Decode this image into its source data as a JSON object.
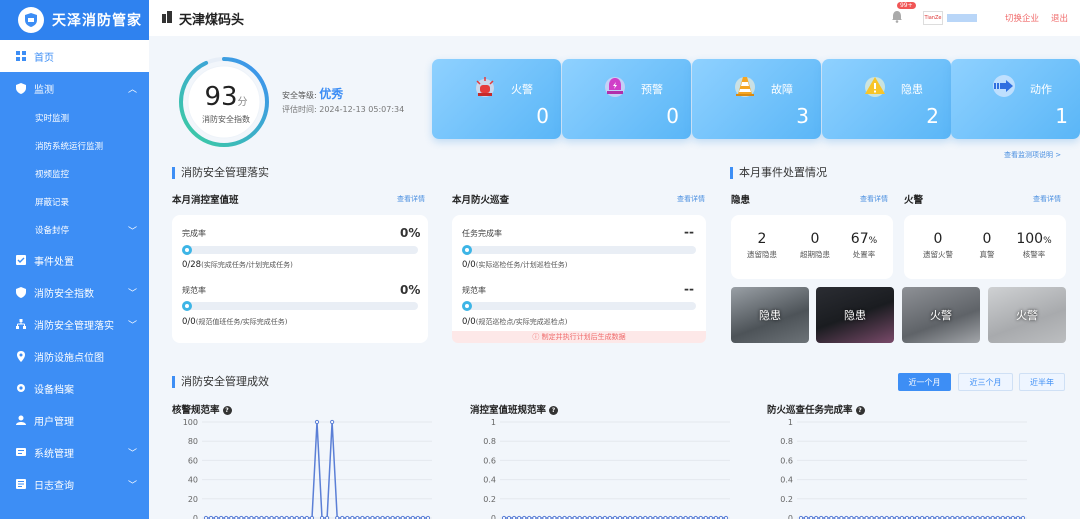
{
  "brand": {
    "title": "天泽消防管家"
  },
  "sidebar": {
    "items": [
      {
        "label": "首页",
        "active": true,
        "icon": "grid-icon"
      },
      {
        "label": "监测",
        "icon": "shield-icon",
        "expanded": true,
        "children": [
          {
            "label": "实时监测"
          },
          {
            "label": "消防系统运行监测"
          },
          {
            "label": "视频监控"
          },
          {
            "label": "屏蔽记录"
          },
          {
            "label": "设备封停",
            "has_children": true
          }
        ]
      },
      {
        "label": "事件处置",
        "icon": "check-square-icon"
      },
      {
        "label": "消防安全指数",
        "icon": "shield-icon",
        "has_children": true
      },
      {
        "label": "消防安全管理落实",
        "icon": "org-chart-icon",
        "has_children": true
      },
      {
        "label": "消防设施点位图",
        "icon": "map-pin-icon"
      },
      {
        "label": "设备档案",
        "icon": "gear-icon"
      },
      {
        "label": "用户管理",
        "icon": "user-icon"
      },
      {
        "label": "系统管理",
        "icon": "settings-icon",
        "has_children": true
      },
      {
        "label": "日志查询",
        "icon": "log-icon",
        "has_children": true
      }
    ]
  },
  "topbar": {
    "site_name": "天津煤码头",
    "notification_badge": "99+",
    "avatar_text": "TianZe",
    "switch_label": "切换企业",
    "logout_label": "退出"
  },
  "score": {
    "value": "93",
    "unit": "分",
    "label": "消防安全指数",
    "level_label": "安全等级:",
    "level_value": "优秀",
    "time_label": "评估时间:",
    "time_value": "2024-12-13 05:07:34",
    "ratio": 0.93
  },
  "stats": [
    {
      "label": "火警",
      "value": "0",
      "icon": "siren-icon"
    },
    {
      "label": "预警",
      "value": "0",
      "icon": "alert-bell-icon"
    },
    {
      "label": "故障",
      "value": "3",
      "icon": "traffic-cone-icon"
    },
    {
      "label": "隐患",
      "value": "2",
      "icon": "warning-triangle-icon"
    },
    {
      "label": "动作",
      "value": "1",
      "icon": "arrow-right-icon"
    }
  ],
  "more_link": "查看监测项说明 >",
  "management": {
    "title": "消防安全管理落实",
    "duty": {
      "title": "本月消控室值班",
      "detail": "查看详情",
      "completion_label": "完成率",
      "completion_value": "0%",
      "completion_ratio_main": "0/28",
      "completion_ratio_note": "(实际完成任务/计划完成任务)",
      "norm_label": "规范率",
      "norm_value": "0%",
      "norm_ratio_main": "0/0",
      "norm_ratio_note": "(规范值班任务/实际完成任务)"
    },
    "patrol": {
      "title": "本月防火巡查",
      "detail": "查看详情",
      "completion_label": "任务完成率",
      "completion_value": "--",
      "completion_ratio_main": "0/0",
      "completion_ratio_note": "(实际巡检任务/计划巡检任务)",
      "norm_label": "规范率",
      "norm_value": "--",
      "norm_ratio_main": "0/0",
      "norm_ratio_note": "(规范巡检点/实际完成巡检点)",
      "warning": "制定并执行计划后生成数据"
    }
  },
  "events": {
    "title": "本月事件处置情况",
    "hazard": {
      "title": "隐患",
      "detail": "查看详情",
      "cells": [
        {
          "n": "2",
          "unit": "",
          "l": "遗留隐患"
        },
        {
          "n": "0",
          "unit": "",
          "l": "超期隐患"
        },
        {
          "n": "67",
          "unit": "%",
          "l": "处置率"
        }
      ]
    },
    "fire": {
      "title": "火警",
      "detail": "查看详情",
      "cells": [
        {
          "n": "0",
          "unit": "",
          "l": "遗留火警"
        },
        {
          "n": "0",
          "unit": "",
          "l": "真警"
        },
        {
          "n": "100",
          "unit": "%",
          "l": "核警率"
        }
      ]
    },
    "photos": [
      "隐患",
      "隐患",
      "火警",
      "火警"
    ]
  },
  "results": {
    "title": "消防安全管理成效",
    "ranges": [
      "近一个月",
      "近三个月",
      "近半年"
    ],
    "active_range": 0
  },
  "chart_data": [
    {
      "type": "line",
      "title": "核警规范率",
      "ylim": [
        0,
        100
      ],
      "yticks": [
        "0",
        "20",
        "40",
        "60",
        "80",
        "100"
      ],
      "values": [
        0,
        0,
        0,
        0,
        0,
        0,
        0,
        0,
        0,
        0,
        0,
        0,
        0,
        0,
        0,
        0,
        0,
        0,
        0,
        0,
        0,
        0,
        100,
        0,
        0,
        100,
        0,
        0,
        0,
        0,
        0,
        0,
        0,
        0,
        0,
        0,
        0,
        0,
        0,
        0,
        0,
        0,
        0,
        0,
        0
      ],
      "grid": true
    },
    {
      "type": "line",
      "title": "消控室值班规范率",
      "ylim": [
        0,
        1
      ],
      "yticks": [
        "0",
        "0.2",
        "0.4",
        "0.6",
        "0.8",
        "1"
      ],
      "values": [
        0,
        0,
        0,
        0,
        0,
        0,
        0,
        0,
        0,
        0,
        0,
        0,
        0,
        0,
        0,
        0,
        0,
        0,
        0,
        0,
        0,
        0,
        0,
        0,
        0,
        0,
        0,
        0,
        0,
        0,
        0,
        0,
        0,
        0,
        0,
        0,
        0,
        0,
        0,
        0,
        0,
        0,
        0,
        0,
        0
      ],
      "grid": true
    },
    {
      "type": "line",
      "title": "防火巡查任务完成率",
      "ylim": [
        0,
        1
      ],
      "yticks": [
        "0",
        "0.2",
        "0.4",
        "0.6",
        "0.8",
        "1"
      ],
      "values": [
        0,
        0,
        0,
        0,
        0,
        0,
        0,
        0,
        0,
        0,
        0,
        0,
        0,
        0,
        0,
        0,
        0,
        0,
        0,
        0,
        0,
        0,
        0,
        0,
        0,
        0,
        0,
        0,
        0,
        0,
        0,
        0,
        0,
        0,
        0,
        0,
        0,
        0,
        0,
        0,
        0,
        0,
        0,
        0,
        0
      ],
      "grid": true
    }
  ]
}
